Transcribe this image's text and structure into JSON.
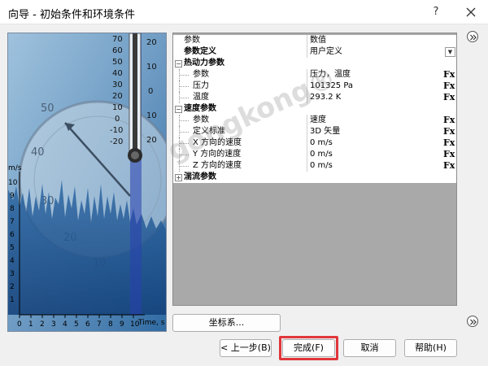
{
  "window": {
    "title": "向导 - 初始条件和环境条件",
    "help_glyph": "?",
    "close_icon": "close-icon"
  },
  "picture": {
    "thermo_ticks": [
      "70",
      "60",
      "50",
      "40",
      "30",
      "20",
      "10",
      "0",
      "-10",
      "-20"
    ],
    "thermo_ticks_right": [
      "20",
      "10",
      "0",
      "10",
      "20"
    ],
    "unit_label": "m/s",
    "y_ticks": [
      "10",
      "9",
      "8",
      "7",
      "6",
      "5",
      "4",
      "3",
      "2",
      "1"
    ],
    "x_ticks": [
      "0",
      "1",
      "2",
      "3",
      "4",
      "5",
      "6",
      "7",
      "8",
      "9",
      "10"
    ],
    "x_label": "Time, s",
    "dial_numbers": [
      "50",
      "40",
      "30",
      "20",
      "10"
    ]
  },
  "grid": {
    "header": {
      "name": "参数",
      "value": "数值"
    },
    "rows": [
      {
        "type": "bold",
        "name": "参数定义",
        "value": "用户定义",
        "dropdown": true
      },
      {
        "type": "section",
        "toggle": "−",
        "name": "热动力参数"
      },
      {
        "type": "sub",
        "name": "参数",
        "value": "压力，温度",
        "fx": "Fx"
      },
      {
        "type": "sub",
        "name": "压力",
        "value": "101325 Pa",
        "fx": "Fx"
      },
      {
        "type": "sub",
        "name": "温度",
        "value": "293.2 K",
        "fx": "Fx"
      },
      {
        "type": "section",
        "toggle": "−",
        "name": "速度参数"
      },
      {
        "type": "sub",
        "name": "参数",
        "value": "速度",
        "fx": "Fx"
      },
      {
        "type": "sub",
        "name": "定义标准",
        "value": "3D 矢量",
        "fx": "Fx"
      },
      {
        "type": "sub",
        "name": "X 方向的速度",
        "value": "0 m/s",
        "fx": "Fx"
      },
      {
        "type": "sub",
        "name": "Y 方向的速度",
        "value": "0 m/s",
        "fx": "Fx"
      },
      {
        "type": "sub",
        "name": "Z 方向的速度",
        "value": "0 m/s",
        "fx": "Fx"
      },
      {
        "type": "section",
        "toggle": "+",
        "name": "湍流参数"
      }
    ]
  },
  "buttons": {
    "coord_system": "坐标系...",
    "back": "< 上一步(B)",
    "finish": "完成(F)",
    "cancel": "取消",
    "help": "帮助(H)"
  },
  "watermark": "gongkong®",
  "colors": {
    "highlight_red": "#e0363b",
    "grid_gray": "#a9a9a9",
    "picture_blue": "#2d6fa8"
  }
}
